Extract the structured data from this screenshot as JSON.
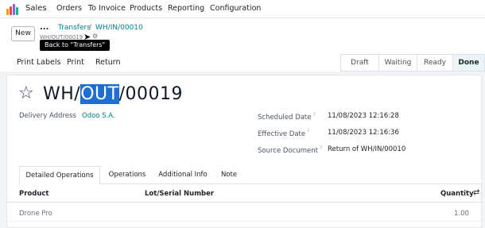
{
  "nav": {
    "app": "Sales",
    "items": [
      "Orders",
      "To Invoice",
      "Products",
      "Reporting",
      "Configuration"
    ],
    "logo_colors": [
      "#f59e0b",
      "#ef4444",
      "#8b5cf6",
      "#10b981"
    ]
  },
  "control": {
    "new_label": "New",
    "ellipsis": "...",
    "breadcrumb_parent": "Transfers",
    "breadcrumb_sep": "/",
    "breadcrumb_current": "WH/IN/00010",
    "record_sub": "WH/OUT/00019",
    "tooltip": "Back to \"Transfers\""
  },
  "actions": [
    "Print Labels",
    "Print",
    "Return"
  ],
  "statuses": [
    {
      "label": "Draft",
      "active": false
    },
    {
      "label": "Waiting",
      "active": false
    },
    {
      "label": "Ready",
      "active": false
    },
    {
      "label": "Done",
      "active": true
    }
  ],
  "form": {
    "title_prefix": "WH/",
    "title_selected": "OUT",
    "title_suffix": "/00019",
    "delivery_label": "Delivery Address",
    "delivery_value": "Odoo S.A.",
    "scheduled_label": "Scheduled Date",
    "scheduled_value": "11/08/2023 12:16:28",
    "effective_label": "Effective Date",
    "effective_value": "11/08/2023 12:16:36",
    "source_label": "Source Document",
    "source_value": "Return of WH/IN/00010",
    "help_mark": "?"
  },
  "tabs": [
    "Detailed Operations",
    "Operations",
    "Additional Info",
    "Note"
  ],
  "table": {
    "headers": {
      "product": "Product",
      "lot": "Lot/Serial Number",
      "quantity": "Quantity"
    },
    "rows": [
      {
        "product": "Drone Pro",
        "quantity": "1.00"
      }
    ]
  }
}
